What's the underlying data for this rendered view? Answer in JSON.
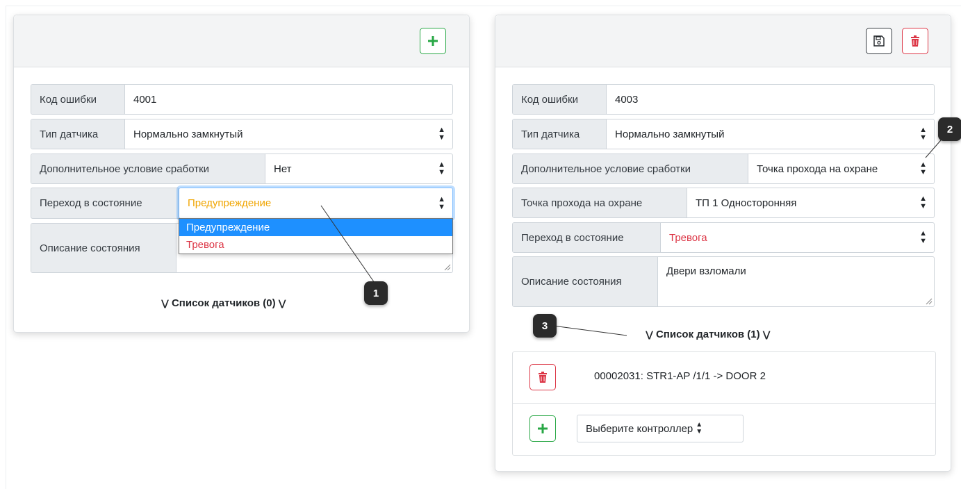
{
  "left_card": {
    "rows": [
      {
        "label": "Код ошибки",
        "value": "4001"
      },
      {
        "label": "Тип датчика",
        "value": "Нормально замкнутый"
      },
      {
        "label": "Дополнительное условие сработки",
        "value": "Нет"
      },
      {
        "label": "Переход в состояние",
        "value": "Предупреждение"
      },
      {
        "label": "Описание состояния",
        "value": ""
      }
    ],
    "dropdown_options": [
      "Предупреждение",
      "Тревога"
    ],
    "sensor_list_title": "Список датчиков (0)"
  },
  "right_card": {
    "rows": [
      {
        "label": "Код ошибки",
        "value": "4003"
      },
      {
        "label": "Тип датчика",
        "value": "Нормально замкнутый"
      },
      {
        "label": "Дополнительное условие сработки",
        "value": "Точка прохода на охране"
      },
      {
        "label": "Точка прохода на охране",
        "value": "ТП 1 Односторонняя"
      },
      {
        "label": "Переход в состояние",
        "value": "Тревога"
      },
      {
        "label": "Описание состояния",
        "value": "Двери взломали"
      }
    ],
    "sensor_list_title": "Список датчиков (1)",
    "sensors": [
      {
        "name": "00002031: STR1-AP /1/1 -> DOOR 2"
      }
    ],
    "controller_select": "Выберите контроллер"
  },
  "callouts": [
    "1",
    "2",
    "3"
  ],
  "colors": {
    "warning_text": "#f0a500",
    "alarm_text": "#dc3545",
    "success": "#28a745",
    "danger": "#dc3545",
    "dropdown_selected": "#1e90ff"
  }
}
